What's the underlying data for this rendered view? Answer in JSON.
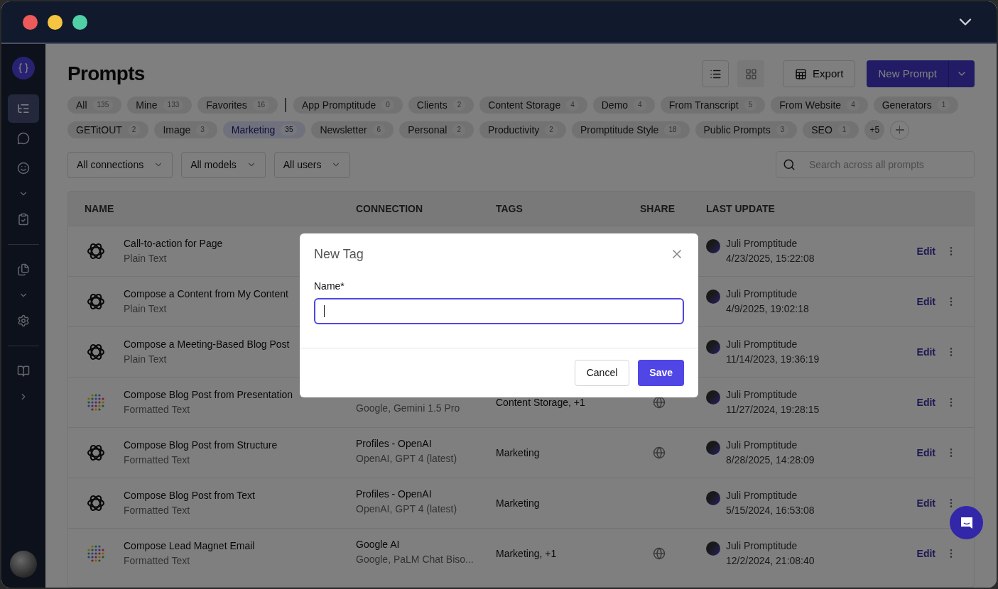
{
  "sidebar": {
    "groups": [
      [
        {
          "kind": "tree",
          "selected": true
        },
        {
          "kind": "chat",
          "selected": false
        },
        {
          "kind": "smile",
          "selected": false
        },
        {
          "kind": "chevron-down",
          "selected": false
        },
        {
          "kind": "clipboard",
          "selected": false
        }
      ],
      [
        {
          "kind": "files",
          "selected": false
        },
        {
          "kind": "chevron-down",
          "selected": false
        },
        {
          "kind": "gear",
          "selected": false
        }
      ],
      [
        {
          "kind": "book",
          "selected": false
        },
        {
          "kind": "chevron-right",
          "selected": false
        }
      ]
    ]
  },
  "page": {
    "title": "Prompts"
  },
  "toolbar": {
    "view_modes": [
      {
        "kind": "list",
        "selected": true
      },
      {
        "kind": "grid",
        "selected": false
      }
    ],
    "export": "Export",
    "new_prompt": "New Prompt"
  },
  "filters": {
    "system": [
      {
        "label": "All",
        "count": "135",
        "selected": false
      },
      {
        "label": "Mine",
        "count": "133",
        "selected": false
      },
      {
        "label": "Favorites",
        "count": "16",
        "selected": false
      }
    ],
    "tags": [
      {
        "label": "App Promptitude",
        "count": "0",
        "selected": false
      },
      {
        "label": "Clients",
        "count": "2",
        "selected": false
      },
      {
        "label": "Content Storage",
        "count": "4",
        "selected": false
      },
      {
        "label": "Demo",
        "count": "4",
        "selected": false
      },
      {
        "label": "From Transcript",
        "count": "5",
        "selected": false
      },
      {
        "label": "From Website",
        "count": "4",
        "selected": false
      },
      {
        "label": "Generators",
        "count": "1",
        "selected": false
      },
      {
        "label": "GETitOUT",
        "count": "2",
        "selected": false
      },
      {
        "label": "Image",
        "count": "3",
        "selected": false
      },
      {
        "label": "Marketing",
        "count": "35",
        "selected": true
      },
      {
        "label": "Newsletter",
        "count": "6",
        "selected": false
      },
      {
        "label": "Personal",
        "count": "2",
        "selected": false
      },
      {
        "label": "Productivity",
        "count": "2",
        "selected": false
      },
      {
        "label": "Promptitude Style",
        "count": "18",
        "selected": false
      },
      {
        "label": "Public Prompts",
        "count": "3",
        "selected": false
      },
      {
        "label": "SEO",
        "count": "1",
        "selected": false
      }
    ],
    "more": "+5"
  },
  "dropdowns": [
    "All connections",
    "All models",
    "All users"
  ],
  "search": {
    "placeholder": "Search across all prompts"
  },
  "table": {
    "columns": [
      "NAME",
      "CONNECTION",
      "TAGS",
      "SHARE",
      "LAST UPDATE"
    ],
    "rows": [
      {
        "kind": "openai",
        "name": "Call-to-action for Page",
        "format": "Plain Text",
        "user": "Juli Promptitude",
        "updated": "4/23/2025, 15:22:08",
        "action": "Edit"
      },
      {
        "kind": "openai",
        "name": "Compose a Content from My Content",
        "format": "Plain Text",
        "user": "Juli Promptitude",
        "updated": "4/9/2025, 19:02:18",
        "action": "Edit"
      },
      {
        "kind": "openai",
        "name": "Compose a Meeting-Based Blog Post",
        "format": "Plain Text",
        "user": "Juli Promptitude",
        "updated": "11/14/2023, 19:36:19",
        "action": "Edit"
      },
      {
        "kind": "google",
        "name": "Compose Blog Post from Presentation",
        "format": "Formatted Text",
        "model": "Google, Gemini 1.5 Pro",
        "tags": "Content Storage, +1",
        "shared": true,
        "user": "Juli Promptitude",
        "updated": "11/27/2024, 19:28:15",
        "action": "Edit"
      },
      {
        "kind": "openai",
        "name": "Compose Blog Post from Structure",
        "format": "Formatted Text",
        "connection": "Profiles - OpenAI",
        "model": "OpenAI, GPT 4 (latest)",
        "tags": "Marketing",
        "shared": true,
        "user": "Juli Promptitude",
        "updated": "8/28/2025, 14:28:09",
        "action": "Edit"
      },
      {
        "kind": "openai",
        "name": "Compose Blog Post from Text",
        "format": "Formatted Text",
        "connection": "Profiles - OpenAI",
        "model": "OpenAI, GPT 4 (latest)",
        "tags": "Marketing",
        "shared": false,
        "user": "Juli Promptitude",
        "updated": "5/15/2024, 16:53:08",
        "action": "Edit"
      },
      {
        "kind": "google",
        "name": "Compose Lead Magnet Email",
        "format": "Formatted Text",
        "connection": "Google AI",
        "model": "Google, PaLM Chat Biso...",
        "tags": "Marketing, +1",
        "shared": true,
        "user": "Juli Promptitude",
        "updated": "12/2/2024, 21:08:40",
        "action": "Edit"
      }
    ]
  },
  "dialog": {
    "title": "New Tag",
    "field_label": "Name*",
    "cancel": "Cancel",
    "save": "Save"
  }
}
